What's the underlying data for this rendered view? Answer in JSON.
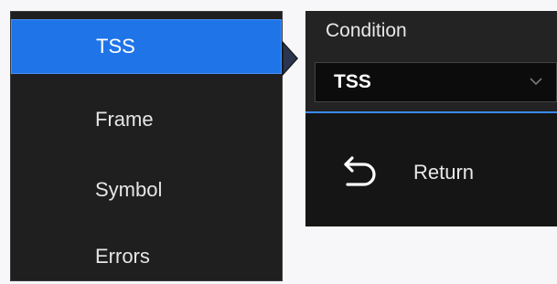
{
  "menu": {
    "items": [
      {
        "label": "TSS",
        "active": true
      },
      {
        "label": "Frame",
        "active": false
      },
      {
        "label": "Symbol",
        "active": false
      },
      {
        "label": "Errors",
        "active": false
      }
    ]
  },
  "panel": {
    "condition_label": "Condition",
    "condition_value": "TSS",
    "return_label": "Return"
  },
  "colors": {
    "accent": "#1f74e8",
    "background": "#1f1f1f"
  }
}
